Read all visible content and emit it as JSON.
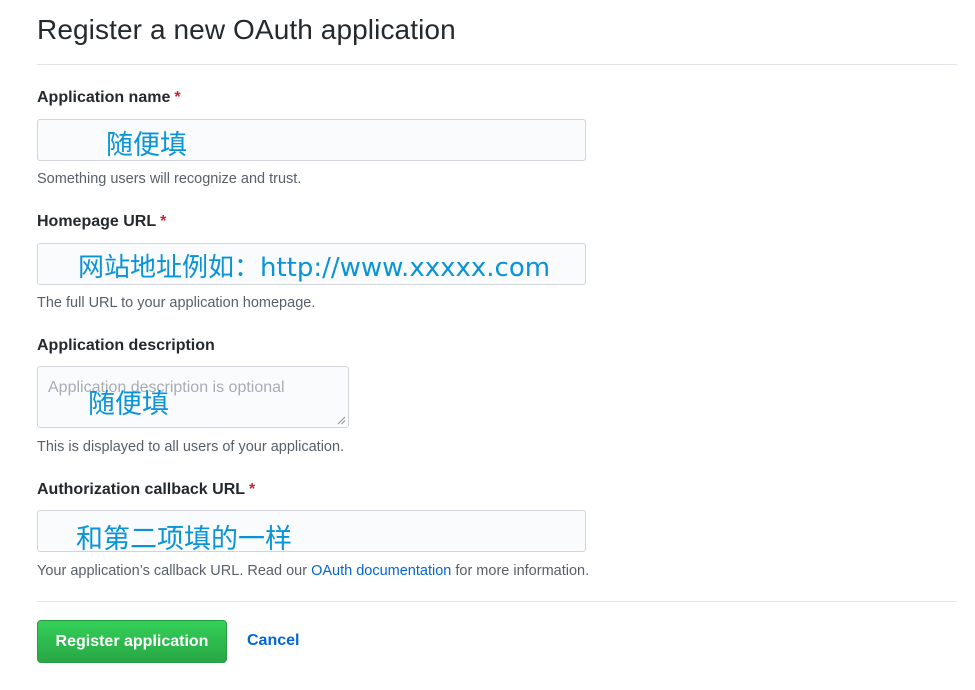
{
  "page": {
    "title": "Register a new OAuth application"
  },
  "fields": {
    "app_name": {
      "label": "Application name",
      "required_mark": "*",
      "annotation": "随便填",
      "help": "Something users will recognize and trust."
    },
    "homepage_url": {
      "label": "Homepage URL",
      "required_mark": "*",
      "annotation": "网站地址例如：http://www.xxxxx.com",
      "help": "The full URL to your application homepage."
    },
    "description": {
      "label": "Application description",
      "placeholder": "Application description is optional",
      "annotation": "随便填",
      "help": "This is displayed to all users of your application."
    },
    "callback_url": {
      "label": "Authorization callback URL",
      "required_mark": "*",
      "annotation": "和第二项填的一样",
      "help_before": "Your application’s callback URL. Read our ",
      "help_link": "OAuth documentation",
      "help_after": " for more information."
    }
  },
  "actions": {
    "register_label": "Register application",
    "cancel_label": "Cancel"
  },
  "colors": {
    "primary_button": "#2ea44f",
    "link": "#0366d6",
    "required": "#cb2431",
    "annotation": "#0a94d8"
  },
  "icons": {
    "textarea_resize": "resize-handle-icon"
  }
}
